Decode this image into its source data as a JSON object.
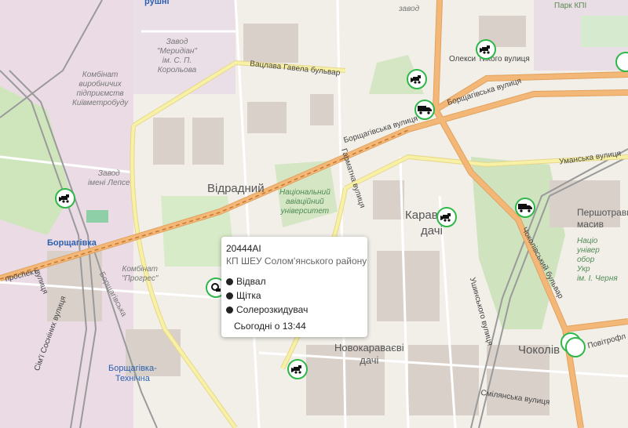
{
  "map": {
    "districts": {
      "vidradnyi": "Відрадний",
      "karavaievi_dachi_1": "Карав",
      "karavaievi_dachi_2": "дачі",
      "novokaravaievi": "Новокараваєві\nдачі",
      "chokolivka": "Чоколів",
      "pershotravnevyi": "Першотравневий\nмасив"
    },
    "streets": {
      "havel": "Вацлава Гавела бульвар",
      "borshch_avenue_1": "Борщагівська вулиця",
      "borshch_avenue_2": "Борщагівська вулиця",
      "oleksy": "Олекси Тихого вулиця",
      "harmatna": "Гарматна вулиця",
      "umanska": "Уманська вулиця",
      "chokolivskyi": "Чоколівський бульвар",
      "ushynskoho": "Ушинського вулиця",
      "smilianska": "Смілянська вулиця",
      "povitroflot": "Повітрофл",
      "prospekt": "проспект",
      "sosnin": "Сім'ї Сосніних вулиця",
      "pshen": "вулиця",
      "rail": "Борщагівська"
    },
    "pois": {
      "meridian": "Завод\n\"Меридіан\"\nім. С. П.\nКорольова",
      "kombinat": "Комбінат\nвиробничих\nпідприємств\nКиївметробуду",
      "lepse": "Завод\nімені Лепсе",
      "progres": "Комбінат\n\"Прогрес\"",
      "zavod_top": "завод",
      "park": "Парк КПІ"
    },
    "university": "Національний\nавіаційний\nуніверситет",
    "university_right": "Націо\nунівер\nобор\nУкр\nім. І. Черня",
    "stations": {
      "borshchahivka": "Борщагівка",
      "tekhnichna": "Борщагівка-\nТехнічна"
    },
    "top_cut": "рушні"
  },
  "markers": [
    {
      "name": "snowplow",
      "color": "#2fb84a"
    },
    {
      "name": "snowplow",
      "color": "#2fb84a"
    },
    {
      "name": "truck",
      "color": "#2fb84a"
    },
    {
      "name": "truck",
      "color": "#2fb84a"
    },
    {
      "name": "snowplow",
      "color": "#2fb84a"
    },
    {
      "name": "truck",
      "color": "#2fb84a"
    },
    {
      "name": "snowplow",
      "color": "#2fb84a"
    },
    {
      "name": "snowplow",
      "color": "#2fb84a"
    },
    {
      "name": "snowplow",
      "color": "#2fb84a"
    }
  ],
  "popup": {
    "vehicle_id": "20444AI",
    "organization": "КП ШЕУ Солом'янського району",
    "equipment": [
      "Відвал",
      "Щітка",
      "Солерозкидувач"
    ],
    "last_seen": "Сьогодні о 13:44"
  },
  "colors": {
    "marker_accent": "#2fb84a",
    "major_road": "#f3b777",
    "secondary_road": "#f7f1a8",
    "park": "#c8e6b6",
    "industrial": "#e8d2de"
  }
}
